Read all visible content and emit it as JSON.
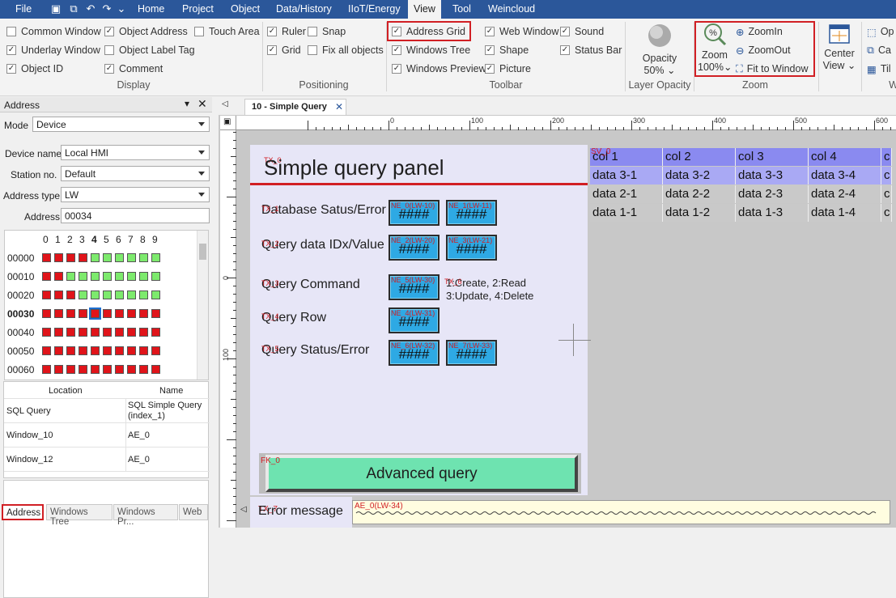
{
  "menu": {
    "file": "File",
    "items": [
      "Home",
      "Project",
      "Object",
      "Data/History",
      "IIoT/Energy",
      "View",
      "Tool",
      "Weincloud"
    ]
  },
  "ribbon": {
    "display": {
      "group_label": "Display",
      "items": [
        {
          "label": "Common Window",
          "checked": false
        },
        {
          "label": "Object Address",
          "checked": true
        },
        {
          "label": "Touch Area",
          "checked": false
        },
        {
          "label": "Underlay Window",
          "checked": true
        },
        {
          "label": "Object Label Tag",
          "checked": false
        },
        {
          "label": "Object ID",
          "checked": true
        },
        {
          "label": "Comment",
          "checked": true
        }
      ]
    },
    "positioning": {
      "group_label": "Positioning",
      "items": [
        {
          "label": "Ruler",
          "checked": true
        },
        {
          "label": "Snap",
          "checked": false
        },
        {
          "label": "Grid",
          "checked": true
        },
        {
          "label": "Fix all objects",
          "checked": false
        }
      ]
    },
    "toolbar": {
      "group_label": "Toolbar",
      "items": [
        {
          "label": "Address Grid",
          "checked": true
        },
        {
          "label": "Web Window",
          "checked": true
        },
        {
          "label": "Sound",
          "checked": true
        },
        {
          "label": "Windows Tree",
          "checked": true
        },
        {
          "label": "Shape",
          "checked": true
        },
        {
          "label": "Status Bar",
          "checked": true
        },
        {
          "label": "Windows Preview",
          "checked": true
        },
        {
          "label": "Picture",
          "checked": true
        }
      ]
    },
    "opacity": {
      "group_label": "Layer Opacity",
      "label": "Opacity",
      "value": "50%"
    },
    "zoom": {
      "group_label": "Zoom",
      "label": "Zoom",
      "value": "100%",
      "zoom_in": "ZoomIn",
      "zoom_out": "ZoomOut",
      "fit": "Fit to Window"
    },
    "center_view": {
      "line1": "Center",
      "line2": "View"
    },
    "truncated": {
      "op": "Op",
      "ca": "Ca",
      "til": "Til",
      "w": "W"
    }
  },
  "address_panel": {
    "title": "Address",
    "mode_label": "Mode",
    "mode_value": "Device",
    "device_name_label": "Device name",
    "device_name_value": "Local HMI",
    "station_label": "Station no.",
    "station_value": "Default",
    "addr_type_label": "Address type",
    "addr_type_value": "LW",
    "address_label": "Address",
    "address_value": "00034",
    "grid_cols": [
      "0",
      "1",
      "2",
      "3",
      "4",
      "5",
      "6",
      "7",
      "8",
      "9"
    ],
    "grid_rows": [
      "00000",
      "00010",
      "00020",
      "00030",
      "00040",
      "00050",
      "00060"
    ],
    "grid_state": [
      "rrrrgggggg",
      "rrgggggggg",
      "rrrggggggg",
      "rrrrrrrrrr",
      "rrrrrrrrrr",
      "rrrrrrrrrr",
      "rrrrrrrrrr"
    ],
    "location_header": "Location",
    "name_header": "Name",
    "location_rows": [
      {
        "location": "SQL Query",
        "name": "SQL Simple Query (index_1)"
      },
      {
        "location": "Window_10",
        "name": "AE_0"
      },
      {
        "location": "Window_12",
        "name": "AE_0"
      }
    ],
    "tabs": [
      "Address",
      "Windows Tree",
      "Windows Pr...",
      "Web"
    ]
  },
  "editor": {
    "tab_title": "10 - Simple Query",
    "ruler_h": [
      "0",
      "100",
      "200",
      "300",
      "400",
      "500",
      "600"
    ],
    "ruler_v": [
      "0",
      "100"
    ],
    "panel_title": "Simple query panel",
    "panel_title_tag": "TX_0",
    "rows": [
      {
        "label": "Database Satus/Error",
        "tag": "TX_1",
        "fields": [
          {
            "tag": "NE_0(LW-10)",
            "value": "####"
          },
          {
            "tag": "NE_1(LW-11)",
            "value": "####"
          }
        ]
      },
      {
        "label": "Query data IDx/Value",
        "tag": "TX_2",
        "fields": [
          {
            "tag": "NE_2(LW-20)",
            "value": "####"
          },
          {
            "tag": "NE_3(LW-21)",
            "value": "####"
          }
        ]
      },
      {
        "label": "Query Command",
        "tag": "TX_3",
        "fields": [
          {
            "tag": "NE_5(LW-30)",
            "value": "####"
          }
        ]
      },
      {
        "label": "Query Row",
        "tag": "TX_4",
        "fields": [
          {
            "tag": "NE_4(LW-31)",
            "value": "####"
          }
        ]
      },
      {
        "label": "Query Status/Error",
        "tag": "TX_5",
        "fields": [
          {
            "tag": "NE_6(LW-32)",
            "value": "####"
          },
          {
            "tag": "NE_7(LW-33)",
            "value": "####"
          }
        ]
      }
    ],
    "command_tag": "TX_6",
    "command_note_line1": "1:Create, 2:Read",
    "command_note_line2": "3:Update, 4:Delete",
    "button_tag": "FK_0",
    "button_label": "Advanced query",
    "error_tag": "TX_7",
    "error_label": "Error message",
    "ae_tag": "AE_0(LW-34)",
    "table_tag": "SV_0",
    "table_headers": [
      "col 1",
      "col 2",
      "col 3",
      "col 4",
      "c"
    ],
    "table_rows": [
      [
        "data 3-1",
        "data 3-2",
        "data 3-3",
        "data 3-4",
        "c"
      ],
      [
        "data 2-1",
        "data 2-2",
        "data 2-3",
        "data 2-4",
        "c"
      ],
      [
        "data 1-1",
        "data 1-2",
        "data 1-3",
        "data 1-4",
        "c"
      ]
    ]
  },
  "colors": {
    "menubar": "#2b579a",
    "highlight": "#d11f24",
    "cell_on": "#7dea6d",
    "cell_off": "#e0141a",
    "field": "#2ea9e4",
    "button": "#6ee3b0",
    "table_header": "#8a8af0"
  }
}
